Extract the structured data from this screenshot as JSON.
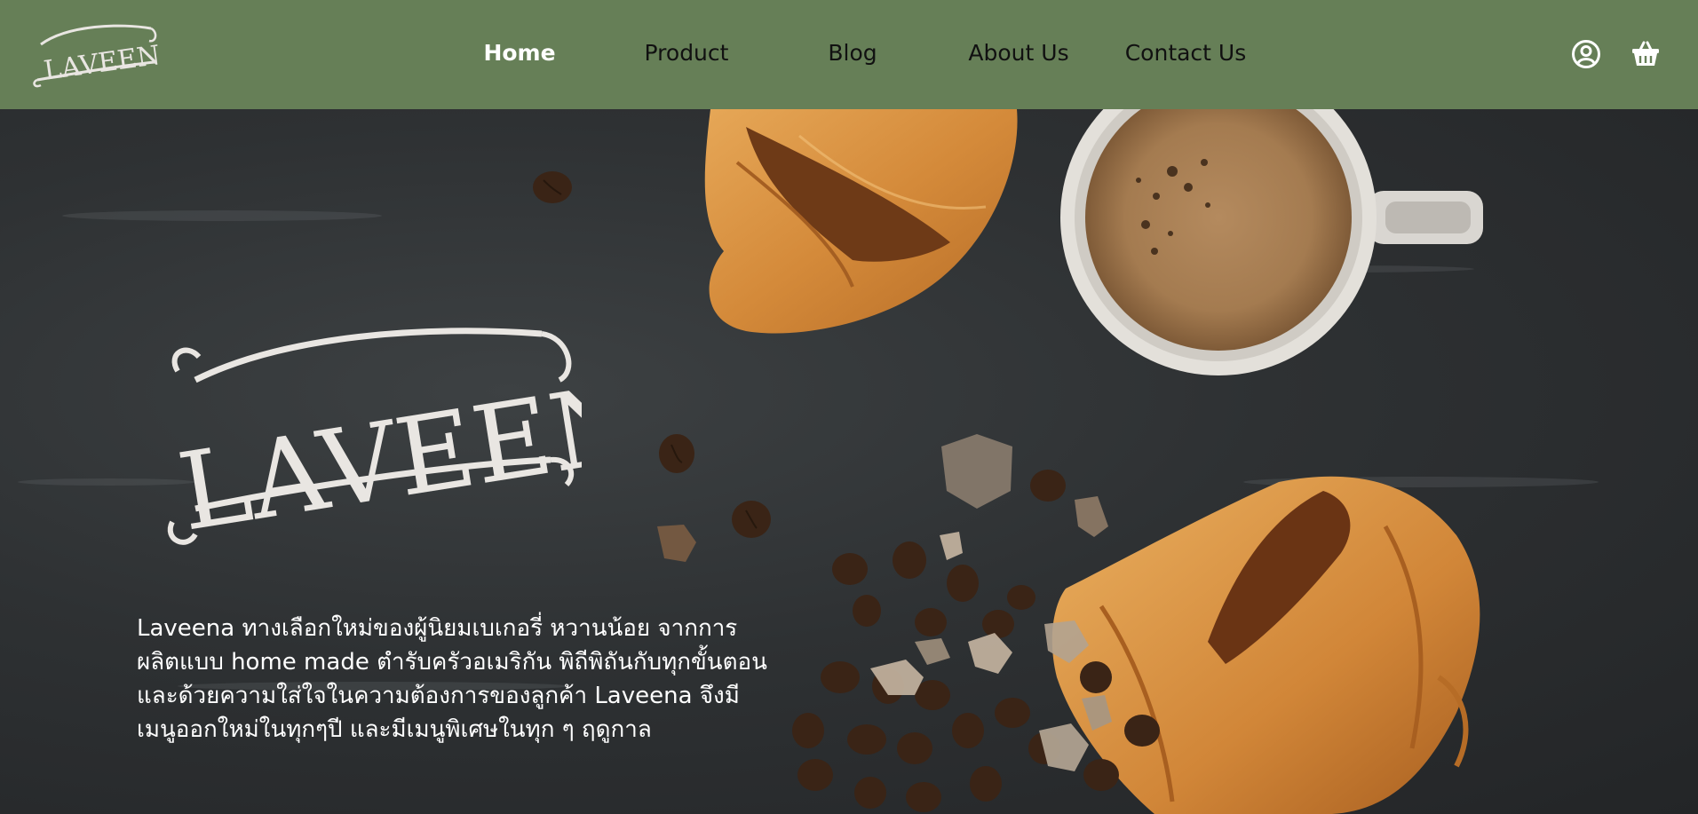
{
  "brand": {
    "logo_text": "LAVEENA",
    "colors": {
      "header_bg": "#667f57",
      "nav_active": "#ffffff",
      "nav_text": "#111111",
      "logo_light": "#e9e6e2"
    }
  },
  "nav": {
    "items": [
      {
        "label": "Home",
        "active": true
      },
      {
        "label": "Product",
        "active": false
      },
      {
        "label": "Blog",
        "active": false
      },
      {
        "label": "About Us",
        "active": false
      },
      {
        "label": "Contact Us",
        "active": false
      }
    ]
  },
  "header_icons": {
    "user": "user-circle-icon",
    "cart": "shopping-basket-icon"
  },
  "hero": {
    "logo_text": "LAVEENA",
    "description": "Laveena ทางเลือกใหม่ของผู้นิยมเบเกอรี่ หวานน้อย จากการผลิตแบบ home made ตำรับครัวอเมริกัน พิถีพิถันกับทุกขั้นตอน และด้วยความใส่ใจในความต้องการของลูกค้า Laveena จึงมีเมนูออกใหม่ในทุกๆปี และมีเมนูพิเศษในทุก ๆ ฤดูกาล"
  }
}
